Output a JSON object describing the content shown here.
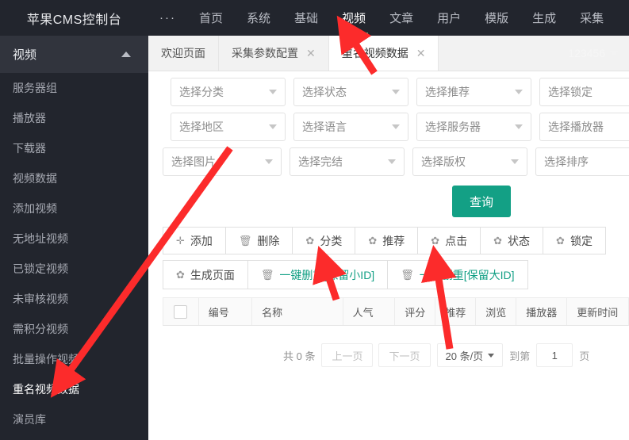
{
  "brand": {
    "title": "苹果CMS控制台"
  },
  "topnav": {
    "dots": "···",
    "items": [
      {
        "label": "首页",
        "active": false
      },
      {
        "label": "系统",
        "active": false
      },
      {
        "label": "基础",
        "active": false
      },
      {
        "label": "视频",
        "active": true
      },
      {
        "label": "文章",
        "active": false
      },
      {
        "label": "用户",
        "active": false
      },
      {
        "label": "模版",
        "active": false
      },
      {
        "label": "生成",
        "active": false
      },
      {
        "label": "采集",
        "active": false
      }
    ]
  },
  "sidebar": {
    "group_title": "视频",
    "items": [
      {
        "label": "服务器组"
      },
      {
        "label": "播放器"
      },
      {
        "label": "下载器"
      },
      {
        "label": "视频数据"
      },
      {
        "label": "添加视频"
      },
      {
        "label": "无地址视频"
      },
      {
        "label": "已锁定视频"
      },
      {
        "label": "未审核视频"
      },
      {
        "label": "需积分视频"
      },
      {
        "label": "批量操作视频"
      },
      {
        "label": "重名视频数据"
      },
      {
        "label": "演员库"
      }
    ]
  },
  "tabs": [
    {
      "label": "欢迎页面",
      "closable": false,
      "active": false
    },
    {
      "label": "采集参数配置",
      "closable": true,
      "active": false
    },
    {
      "label": "重名视频数据",
      "closable": true,
      "active": true
    }
  ],
  "tab_close_glyph": "✕",
  "user": {
    "name": "123456"
  },
  "filters": {
    "row1": [
      {
        "label": "选择分类"
      },
      {
        "label": "选择状态"
      },
      {
        "label": "选择推荐"
      },
      {
        "label": "选择锁定"
      }
    ],
    "row2": [
      {
        "label": "选择地区"
      },
      {
        "label": "选择语言"
      },
      {
        "label": "选择服务器"
      },
      {
        "label": "选择播放器"
      }
    ],
    "row3": [
      {
        "label": "选择图片"
      },
      {
        "label": "选择完结"
      },
      {
        "label": "选择版权"
      },
      {
        "label": "选择排序"
      }
    ],
    "query_button": "查询"
  },
  "toolbar": {
    "row1": [
      {
        "icon": "plus",
        "glyph": "✛",
        "label": "添加"
      },
      {
        "icon": "trash",
        "glyph": "🗑",
        "label": "删除"
      },
      {
        "icon": "gear",
        "glyph": "✿",
        "label": "分类"
      },
      {
        "icon": "gear",
        "glyph": "✿",
        "label": "推荐"
      },
      {
        "icon": "gear",
        "glyph": "✿",
        "label": "点击"
      },
      {
        "icon": "gear",
        "glyph": "✿",
        "label": "状态"
      },
      {
        "icon": "gear",
        "glyph": "✿",
        "label": "锁定"
      }
    ],
    "row2": [
      {
        "icon": "gear",
        "glyph": "✿",
        "label": "生成页面",
        "accent": false
      },
      {
        "icon": "trash",
        "glyph": "🗑",
        "label": "一键删重[保留小ID]",
        "accent": true
      },
      {
        "icon": "trash",
        "glyph": "🗑",
        "label": "一键删重[保留大ID]",
        "accent": true
      }
    ]
  },
  "table": {
    "columns": [
      {
        "label": "编号",
        "width": 70
      },
      {
        "label": "名称",
        "width": 120
      },
      {
        "label": "人气",
        "width": 68
      },
      {
        "label": "评分",
        "width": 52
      },
      {
        "label": "推荐",
        "width": 52
      },
      {
        "label": "浏览",
        "width": 52
      },
      {
        "label": "播放器",
        "width": 66
      },
      {
        "label": "更新时间",
        "width": 80
      }
    ],
    "rows": []
  },
  "pagination": {
    "total_text": "共 0 条",
    "prev": "上一页",
    "next": "下一页",
    "page_size": "20 条/页",
    "goto_label": "到第",
    "page_value": "1",
    "page_unit": "页"
  },
  "colors": {
    "topbar_bg": "#22252d",
    "sidebar_bg": "#22252d",
    "sidebar_head_bg": "#31343d",
    "accent_green": "#5bb37f",
    "accent_teal": "#13a085",
    "annotation_red": "#fc2b2b"
  },
  "annotations": [
    {
      "name": "arrow-to-video-nav"
    },
    {
      "name": "arrow-to-rename-video-data"
    },
    {
      "name": "arrow-to-dedupe-small-id"
    },
    {
      "name": "arrow-to-dedupe-large-id"
    }
  ]
}
